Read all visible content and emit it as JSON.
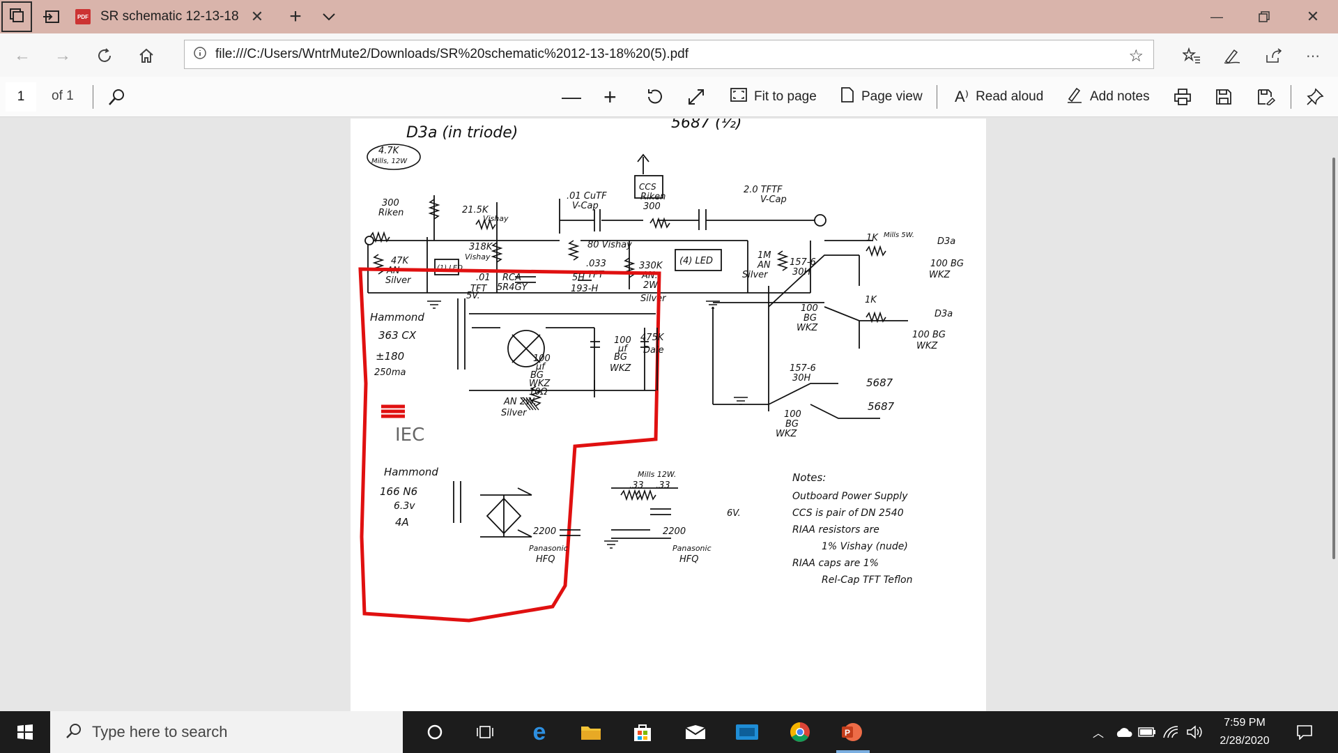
{
  "browser": {
    "tab": {
      "title": "SR schematic 12-13-18",
      "badge": "PDF"
    },
    "address": {
      "url": "file:///C:/Users/WntrMute2/Downloads/SR%20schematic%2012-13-18%20(5).pdf"
    }
  },
  "pdf_toolbar": {
    "page_number": "1",
    "page_of": "of 1",
    "fit_to_page": "Fit to page",
    "page_view": "Page view",
    "read_aloud": "Read aloud",
    "add_notes": "Add notes"
  },
  "schematic": {
    "headings": [
      "D3a (in triode)",
      "5687 (½)"
    ],
    "labels": [
      "4.7K",
      "Mills, 12W",
      "300",
      "Riken",
      "21.5K",
      "Vishay",
      ".01 CuTF",
      "V-Cap",
      "Riken",
      "300",
      "CCS",
      "2.0 TFTF",
      "V-Cap",
      "318K",
      "Vishay",
      "80 Vishay",
      ".033",
      "TFT",
      "330K",
      "AN.",
      "2W.",
      "Silver",
      "(4) LED",
      "1M",
      "AN",
      "Silver",
      "47K",
      "AN",
      "Silver",
      "(1) LED",
      ".01",
      "TFT",
      "1K",
      "Mills 5W.",
      "D3a",
      "100 BG",
      "WKZ",
      "157-6",
      "30H",
      "1K",
      "D3a",
      "100 BG",
      "WKZ",
      "100",
      "BG",
      "WKZ",
      "RCA",
      "5R4GY",
      "5H",
      "193-H",
      "5V.",
      "Hammond",
      "363 CX",
      "±180",
      "250ma",
      "100",
      "µf",
      "BG",
      "WKZ",
      "100",
      "µf",
      "BG",
      "WKZ",
      "475K",
      "Dale",
      "10Ω",
      "AN 2W.",
      "Silver",
      "157-6",
      "30H",
      "5687",
      "5687",
      "100",
      "BG",
      "WKZ",
      "IEC",
      "Hammond",
      "166 N6",
      "6.3v",
      "4A",
      "Mills 12W.",
      ".33",
      ".33",
      "6V.",
      "2200",
      "Panasonic",
      "HFQ",
      "2200",
      "Panasonic",
      "HFQ",
      "Notes:",
      "Outboard Power Supply",
      "CCS is pair of DN 2540",
      "RIAA resistors are",
      "1% Vishay (nude)",
      "RIAA caps are 1%",
      "Rel-Cap TFT Teflon"
    ]
  },
  "taskbar": {
    "search_placeholder": "Type here to search",
    "time": "7:59 PM",
    "date": "2/28/2020"
  },
  "colors": {
    "titlebar": "#d9b4ab",
    "marker": "#e01010",
    "ink": "#111111"
  }
}
